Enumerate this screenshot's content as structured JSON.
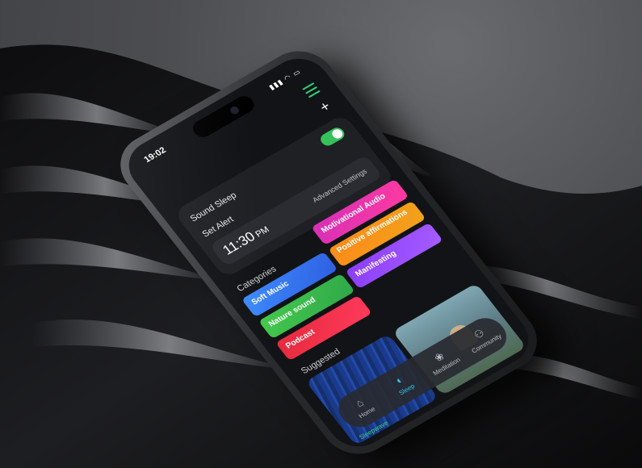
{
  "status_bar": {
    "time": "19:02",
    "icons": "▮▮▮ ◠ ▭"
  },
  "header": {
    "menu_icon": "hamburger-icon",
    "add_icon": "plus-icon",
    "add_glyph": "+"
  },
  "alert_card": {
    "sound_sleep_label": "Sound Sleep",
    "toggle_on": true,
    "set_alert_label": "Set Alert",
    "alarm_time": "11:30",
    "alarm_ampm": "PM",
    "advanced_settings_label": "Advanced Settings"
  },
  "categories": {
    "title": "Categories",
    "items": [
      {
        "label": "Soft Music",
        "color": "#3d8cff"
      },
      {
        "label": "Positive affirmations",
        "color": "#ff8a1a"
      },
      {
        "label": "Nature sound",
        "color": "#45c94d"
      },
      {
        "label": "Manifesting",
        "color": "#8b3dff"
      },
      {
        "label": "Podcast",
        "color": "#e52a3c"
      },
      {
        "label": "Motivational Audio",
        "color": "#d62fb8"
      }
    ]
  },
  "suggested": {
    "title": "Suggested"
  },
  "tabbar": {
    "tabs": [
      {
        "label": "Home",
        "icon": "home-icon",
        "glyph": "⌂"
      },
      {
        "label": "Sleep",
        "icon": "moon-icon",
        "glyph": "◐",
        "active": true
      },
      {
        "label": "Meditation",
        "icon": "lotus-icon",
        "glyph": "❀"
      },
      {
        "label": "Community",
        "icon": "people-icon",
        "glyph": "⚇"
      }
    ]
  },
  "now_playing": {
    "label": "Sleepwave"
  },
  "colors": {
    "accent": "#29c7e8",
    "toggle": "#35c25a",
    "menu": "#2fd27a",
    "background": "#121316"
  }
}
